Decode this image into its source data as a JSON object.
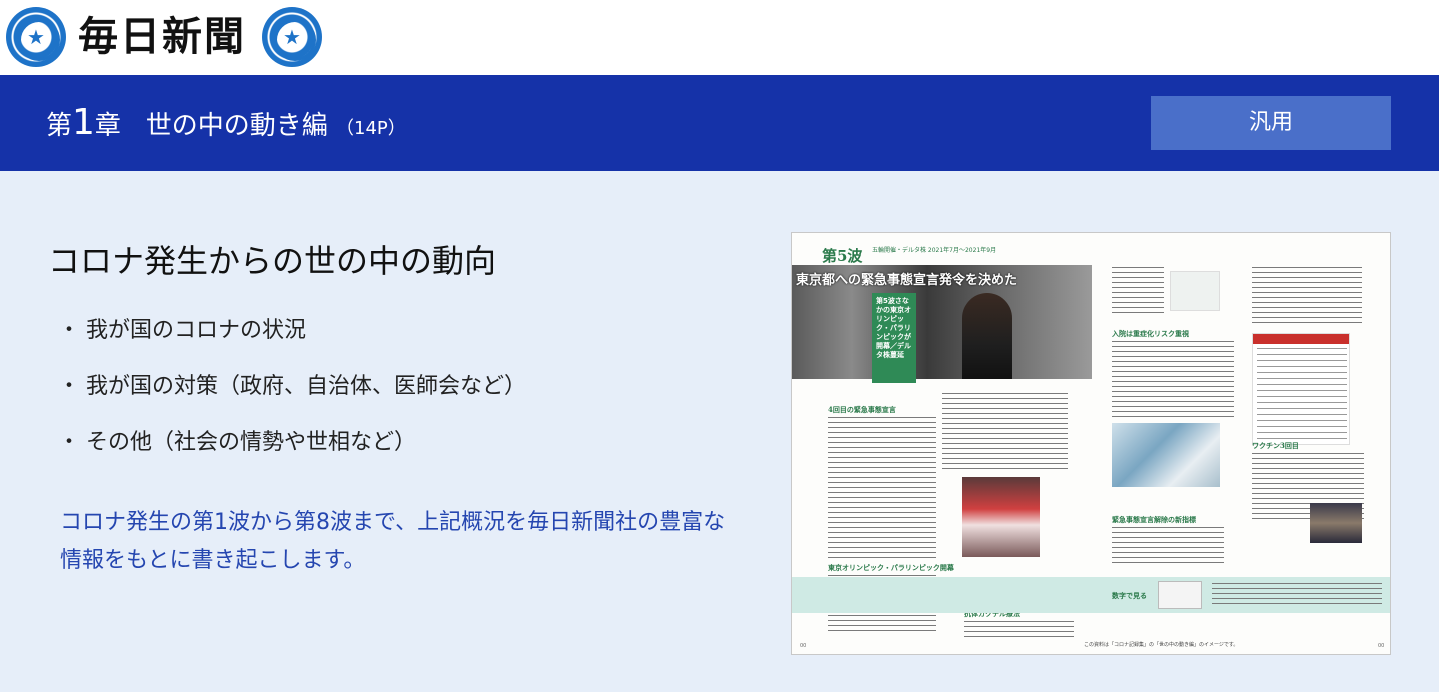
{
  "header": {
    "logo_text": "毎日新聞",
    "logo_icon": "mainichi-emblem-icon"
  },
  "chapter": {
    "prefix": "第",
    "number": "1",
    "suffix": "章",
    "title": "世の中の動き編",
    "pages": "（14P）",
    "tag_label": "汎用"
  },
  "content": {
    "section_title": "コロナ発生からの世の中の動向",
    "bullet_mark": "・",
    "bullets": [
      "我が国のコロナの状況",
      "我が国の対策（政府、自治体、医師会など）",
      "その他（社会の情勢や世相など）"
    ],
    "summary": "コロナ発生の第1波から第8波まで、上記概況を毎日新聞社の豊富な情報をもとに書き起こします。"
  },
  "spread": {
    "wave_label": "第5波",
    "wave_period": "五輪開催・デルタ株 2021年7月〜2021年9月",
    "headline": "東京都への緊急事態宣言発令を決めた",
    "vertical_text": "第5波さなかの東京オリンピック・パラリンピックが開幕／デルタ株蔓延",
    "subheads": {
      "s1": "4回目の緊急事態宣言",
      "s2": "東京オリンピック・パラリンピック開幕",
      "s3": "抗体カクテル療法",
      "s4": "入院は重症化リスク重視",
      "s5": "緊急事態宣言解除の新指標",
      "s6": "ワクチン3回目",
      "s7": "数字で見る"
    },
    "bottom_note": "この資料は「コロナ記録集」の「世の中の動き編」のイメージです。",
    "page_left": "00",
    "page_right": "00"
  }
}
